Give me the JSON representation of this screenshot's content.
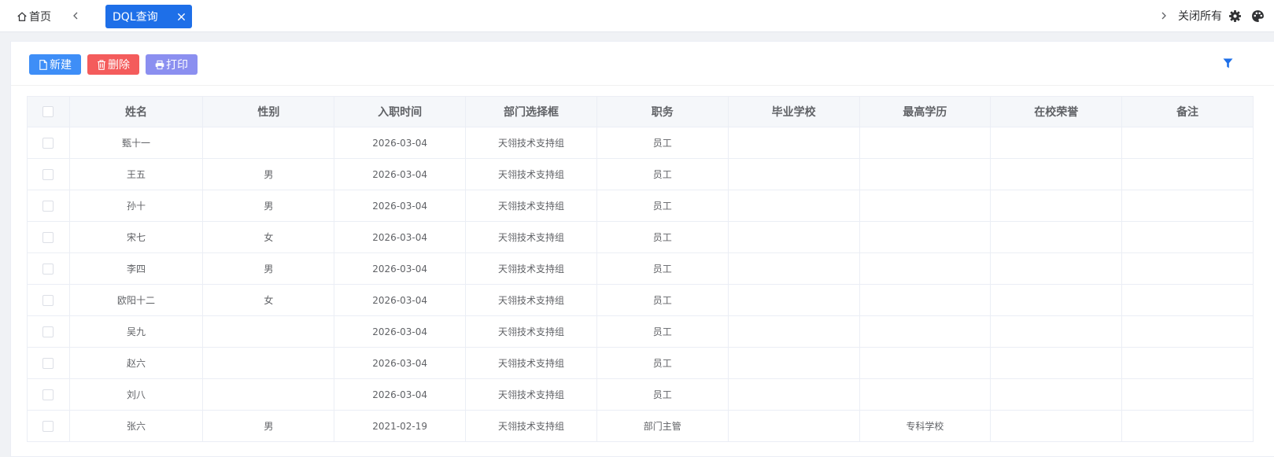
{
  "tabs_bar": {
    "home_label": "首页",
    "active_tab_label": "DQL查询",
    "close_all_label": "关闭所有"
  },
  "toolbar": {
    "new_label": "新建",
    "delete_label": "删除",
    "print_label": "打印"
  },
  "table": {
    "columns": [
      "姓名",
      "性别",
      "入职时间",
      "部门选择框",
      "职务",
      "毕业学校",
      "最高学历",
      "在校荣誉",
      "备注"
    ],
    "rows": [
      [
        "甄十一",
        "",
        "2026-03-04",
        "天翎技术支持组",
        "员工",
        "",
        "",
        "",
        ""
      ],
      [
        "王五",
        "男",
        "2026-03-04",
        "天翎技术支持组",
        "员工",
        "",
        "",
        "",
        ""
      ],
      [
        "孙十",
        "男",
        "2026-03-04",
        "天翎技术支持组",
        "员工",
        "",
        "",
        "",
        ""
      ],
      [
        "宋七",
        "女",
        "2026-03-04",
        "天翎技术支持组",
        "员工",
        "",
        "",
        "",
        ""
      ],
      [
        "李四",
        "男",
        "2026-03-04",
        "天翎技术支持组",
        "员工",
        "",
        "",
        "",
        ""
      ],
      [
        "欧阳十二",
        "女",
        "2026-03-04",
        "天翎技术支持组",
        "员工",
        "",
        "",
        "",
        ""
      ],
      [
        "吴九",
        "",
        "2026-03-04",
        "天翎技术支持组",
        "员工",
        "",
        "",
        "",
        ""
      ],
      [
        "赵六",
        "",
        "2026-03-04",
        "天翎技术支持组",
        "员工",
        "",
        "",
        "",
        ""
      ],
      [
        "刘八",
        "",
        "2026-03-04",
        "天翎技术支持组",
        "员工",
        "",
        "",
        "",
        ""
      ],
      [
        "张六",
        "男",
        "2021-02-19",
        "天翎技术支持组",
        "部门主管",
        "",
        "专科学校",
        "",
        ""
      ]
    ]
  },
  "colors": {
    "primary": "#1e6fe8",
    "new_button": "#3e8ef7",
    "delete_button": "#f45c5c",
    "print_button": "#8b8ff0",
    "header_bg": "#f5f7fa"
  },
  "icons": {
    "home": "home-icon",
    "tab_prev": "chevron-left-icon",
    "tab_next": "chevron-right-icon",
    "tab_close": "close-icon",
    "settings": "gear-icon",
    "theme": "palette-icon",
    "new": "file-icon",
    "delete": "trash-icon",
    "print": "printer-icon",
    "filter": "filter-icon"
  }
}
